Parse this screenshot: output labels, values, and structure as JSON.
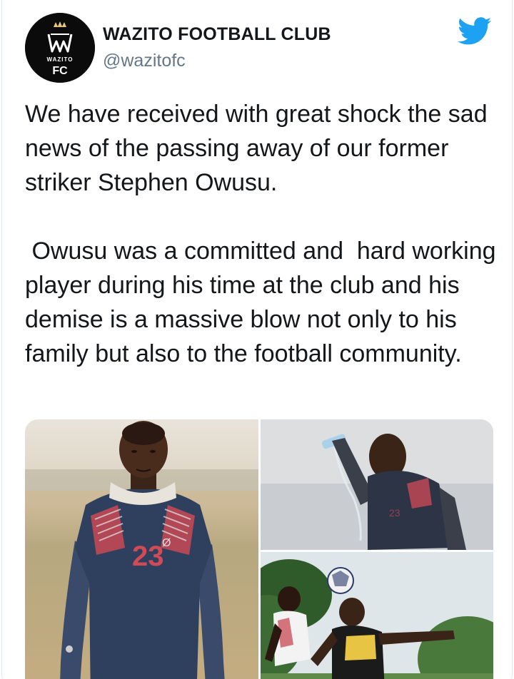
{
  "account": {
    "name": "WAZITO FOOTBALL CLUB",
    "handle": "@wazitofc",
    "logo_text": "WAZITO",
    "logo_monogram": "FC"
  },
  "tweet": {
    "paragraph_1": "We have received with great shock the sad news of the passing away of our former striker Stephen Owusu.",
    "paragraph_2": " Owusu was a committed and  hard working player during his time at the club and his demise is a massive blow not only to his family but also to the football community."
  },
  "media": {
    "jersey_number": "23"
  },
  "icons": {
    "brand": "twitter-bird-icon",
    "avatar": "wazito-fc-logo"
  },
  "colors": {
    "twitter_blue": "#1da1f2",
    "handle_gray": "#657786",
    "text": "#14171a",
    "border": "#e1e8ed"
  }
}
